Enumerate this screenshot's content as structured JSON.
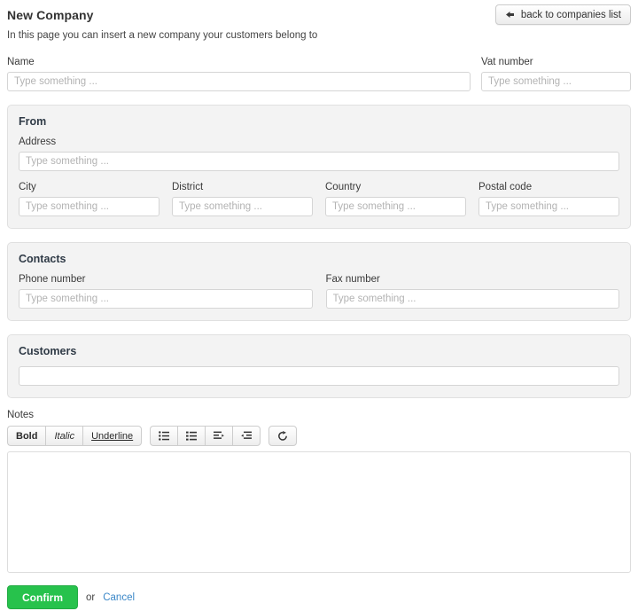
{
  "header": {
    "title": "New Company",
    "subtitle": "In this page you can insert a new company your customers belong to",
    "back_button_label": "back to companies list",
    "back_button_icon": "arrow-left-icon"
  },
  "form": {
    "name": {
      "label": "Name",
      "value": "",
      "placeholder": "Type something ..."
    },
    "vat_number": {
      "label": "Vat number",
      "value": "",
      "placeholder": "Type something ..."
    }
  },
  "from_panel": {
    "title": "From",
    "address": {
      "label": "Address",
      "value": "",
      "placeholder": "Type something ..."
    },
    "city": {
      "label": "City",
      "value": "",
      "placeholder": "Type something ..."
    },
    "district": {
      "label": "District",
      "value": "",
      "placeholder": "Type something ..."
    },
    "country": {
      "label": "Country",
      "value": "",
      "placeholder": "Type something ..."
    },
    "postal_code": {
      "label": "Postal code",
      "value": "",
      "placeholder": "Type something ..."
    }
  },
  "contacts_panel": {
    "title": "Contacts",
    "phone_number": {
      "label": "Phone number",
      "value": "",
      "placeholder": "Type something ..."
    },
    "fax_number": {
      "label": "Fax number",
      "value": "",
      "placeholder": "Type something ..."
    }
  },
  "customers_panel": {
    "title": "Customers",
    "input": {
      "value": "",
      "placeholder": ""
    }
  },
  "notes": {
    "label": "Notes",
    "toolbar": {
      "bold": "Bold",
      "italic": "Italic",
      "underline": "Underline",
      "unordered_list_icon": "unordered-list-icon",
      "ordered_list_icon": "ordered-list-icon",
      "indent_icon": "indent-icon",
      "outdent_icon": "outdent-icon",
      "redo_icon": "redo-icon"
    },
    "value": ""
  },
  "footer": {
    "confirm_label": "Confirm",
    "or_label": "or",
    "cancel_label": "Cancel"
  },
  "colors": {
    "confirm_green": "#27c24c",
    "cancel_link": "#3a87c8",
    "panel_bg": "#f3f3f3",
    "panel_border": "#e0e0e0",
    "input_border": "#d5d5d5",
    "placeholder": "#b3b3b3"
  }
}
